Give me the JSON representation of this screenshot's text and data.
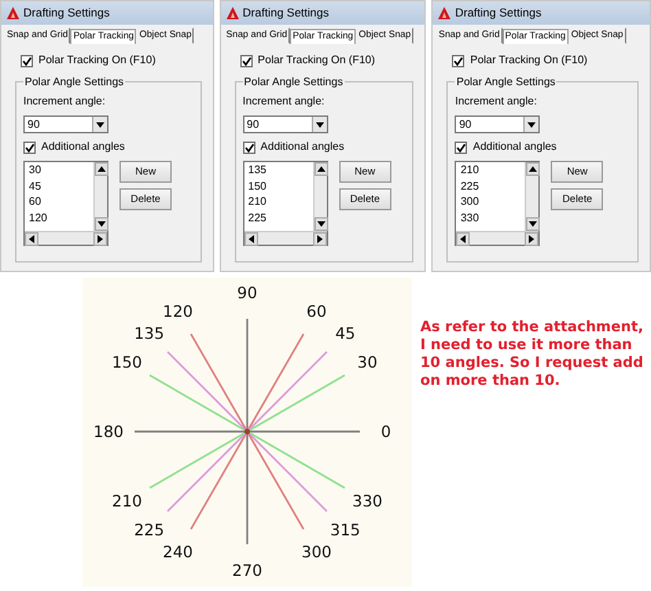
{
  "panels": [
    {
      "title": "Drafting Settings",
      "tabs": [
        {
          "label": "Snap and Grid",
          "selected": false
        },
        {
          "label": "Polar Tracking",
          "selected": true
        },
        {
          "label": "Object Snap",
          "selected": false
        }
      ],
      "tracking_on": {
        "label": "Polar Tracking On (F10)",
        "checked": true
      },
      "group_title": "Polar Angle Settings",
      "increment_label": "Increment angle:",
      "increment_value": "90",
      "additional": {
        "label": "Additional angles",
        "checked": true
      },
      "angles": [
        "30",
        "45",
        "60",
        "120"
      ],
      "buttons": [
        "New",
        "Delete"
      ]
    },
    {
      "title": "Drafting Settings",
      "tabs": [
        {
          "label": "Snap and Grid",
          "selected": false
        },
        {
          "label": "Polar Tracking",
          "selected": true
        },
        {
          "label": "Object Snap",
          "selected": false
        }
      ],
      "tracking_on": {
        "label": "Polar Tracking On (F10)",
        "checked": true
      },
      "group_title": "Polar Angle Settings",
      "increment_label": "Increment angle:",
      "increment_value": "90",
      "additional": {
        "label": "Additional angles",
        "checked": true
      },
      "angles": [
        "135",
        "150",
        "210",
        "225"
      ],
      "buttons": [
        "New",
        "Delete"
      ]
    },
    {
      "title": "Drafting Settings",
      "tabs": [
        {
          "label": "Snap and Grid",
          "selected": false
        },
        {
          "label": "Polar Tracking",
          "selected": true
        },
        {
          "label": "Object Snap",
          "selected": false
        }
      ],
      "tracking_on": {
        "label": "Polar Tracking On (F10)",
        "checked": true
      },
      "group_title": "Polar Angle Settings",
      "increment_label": "Increment angle:",
      "increment_value": "90",
      "additional": {
        "label": "Additional angles",
        "checked": true
      },
      "angles": [
        "210",
        "225",
        "300",
        "330"
      ],
      "buttons": [
        "New",
        "Delete"
      ]
    }
  ],
  "diagram": {
    "rays": [
      {
        "label": "90",
        "color": "#808080"
      },
      {
        "label": "60",
        "color": "#e08080"
      },
      {
        "label": "45",
        "color": "#e098e0"
      },
      {
        "label": "30",
        "color": "#90e090"
      },
      {
        "label": "0",
        "color": "#808080"
      },
      {
        "label": "330",
        "color": "#90e090"
      },
      {
        "label": "315",
        "color": "#e098e0"
      },
      {
        "label": "300",
        "color": "#e08080"
      },
      {
        "label": "270",
        "color": "#808080"
      },
      {
        "label": "240",
        "color": "#e08080"
      },
      {
        "label": "225",
        "color": "#e098e0"
      },
      {
        "label": "210",
        "color": "#90e090"
      },
      {
        "label": "180",
        "color": "#808080"
      },
      {
        "label": "150",
        "color": "#90e090"
      },
      {
        "label": "135",
        "color": "#e098e0"
      },
      {
        "label": "120",
        "color": "#e08080"
      }
    ]
  },
  "note": "As refer to the attachment, I need to use it more than 10 angles. So I request add on more than 10."
}
